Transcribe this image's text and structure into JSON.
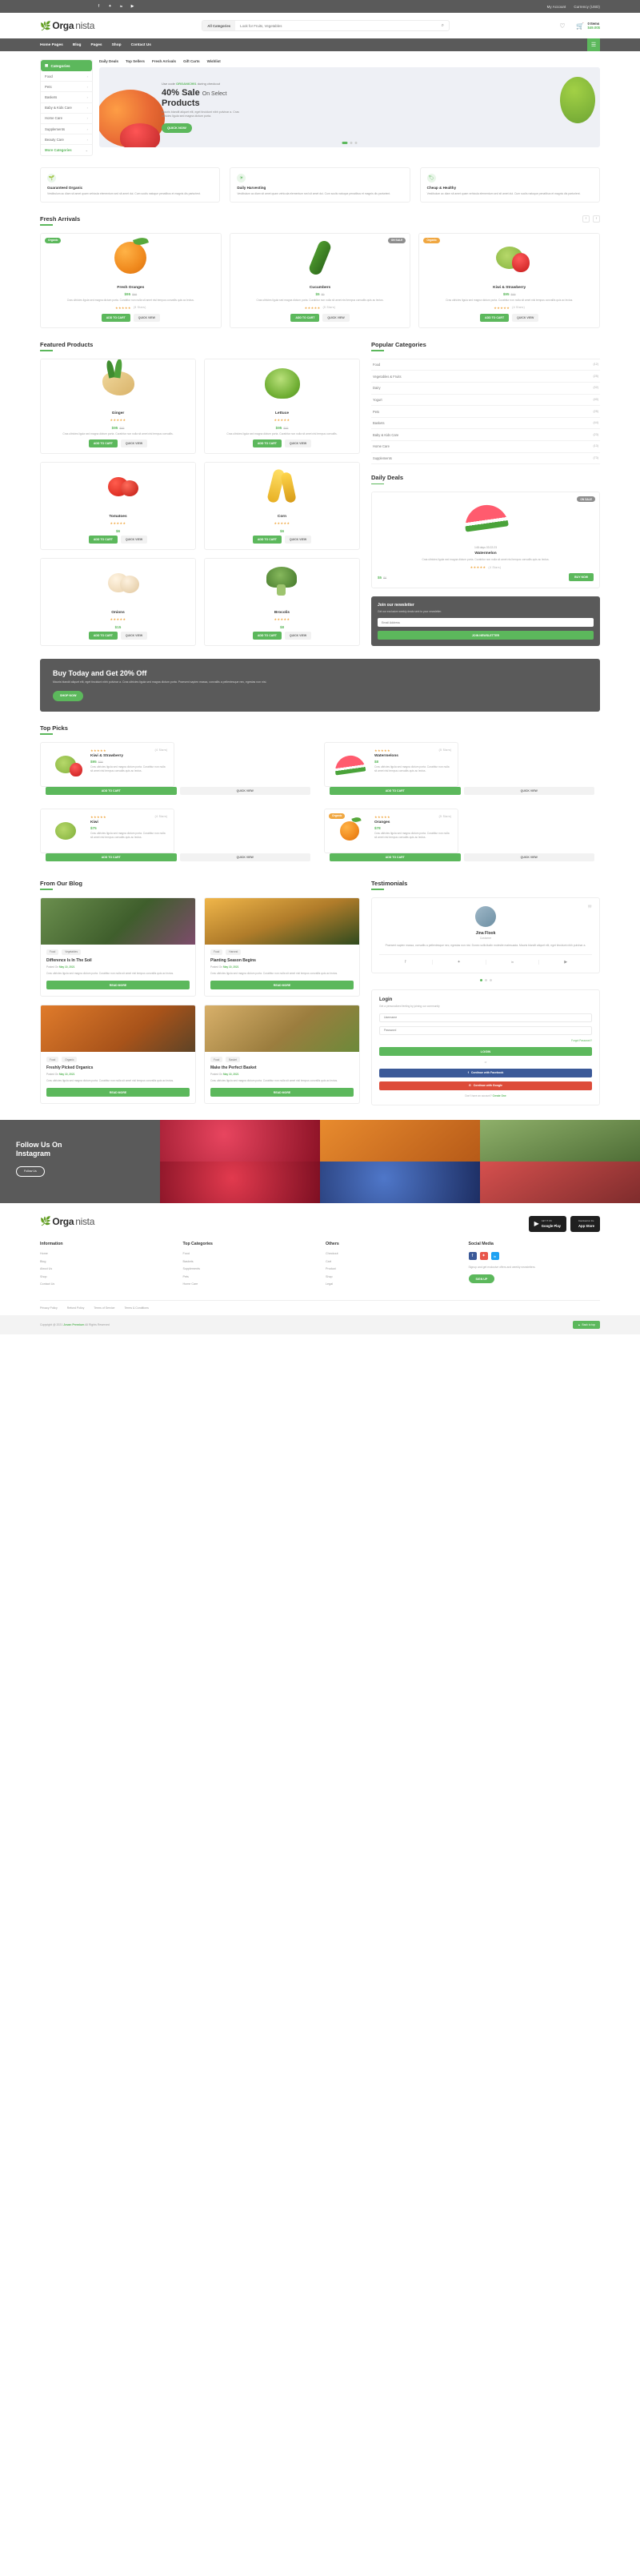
{
  "topbar": {
    "social": [
      "f",
      "t",
      "in",
      "yt"
    ],
    "links": [
      "My Account",
      "Currency (USD)"
    ]
  },
  "header": {
    "logo_main": "Orga",
    "logo_light": "nista",
    "search_category": "All Categories",
    "search_placeholder": "Look for Fruits, Vegetables",
    "wishlist_icon": "heart-icon",
    "cart_items": "0 Items",
    "cart_price": "$49.00$"
  },
  "nav": {
    "links": [
      "Home Pages",
      "Blog",
      "Pages",
      "Shop",
      "Contact Us"
    ]
  },
  "hero": {
    "categories_title": "Categories",
    "categories": [
      "Food",
      "Pets",
      "Baskets",
      "Baby & Kids Care",
      "Home Care",
      "Supplements",
      "Beauty Care"
    ],
    "more_label": "More Categories",
    "tabs": [
      "Daily Deals",
      "Top Sellers",
      "Fresh Arrivals",
      "Gift Carts",
      "Wishlist"
    ],
    "promo_code_pre": "Use code",
    "promo_code": "ORGANIC991",
    "promo_code_post": "during checkout",
    "promo_title_1": "40% Sale",
    "promo_title_2": "On Select",
    "promo_title_3": "Products",
    "promo_desc": "Mauris blandit aliquet elit, eget tincidunt nibh pulvinar a. Cras ultricies ligula sed magna dictum porta.",
    "promo_cta": "QUICK NOW"
  },
  "features": [
    {
      "icon": "leaf-icon",
      "title": "Guaranteed Organic",
      "desc": "Vestibulum ac diam sit amet quam vehicula elementum sed sit amet dui. Cum sociis natoque penatibus et magnis dis parturient."
    },
    {
      "icon": "sun-icon",
      "title": "Daily Harvesting",
      "desc": "Vestibulum ac diam sit amet quam vehicula elementum sed sit amet dui. Cum sociis natoque penatibus et magnis dis parturient."
    },
    {
      "icon": "tag-icon",
      "title": "Cheap & Healthy",
      "desc": "Vestibulum ac diam sit amet quam vehicula elementum sed sit amet dui. Cum sociis natoque penatibus et magnis dis parturient."
    }
  ],
  "fresh_arrivals": {
    "title": "Fresh Arrivals",
    "products": [
      {
        "badge": "Organic",
        "badge_type": "green",
        "name": "Fresh Oranges",
        "price": "$95",
        "old": "$99",
        "desc": "Cras ultricies ligula sed magna dictum porta. Curabitur non nulla sit amet nisl tempus convallis quis ac lectus.",
        "stars": "★★★★★",
        "reviews": "(5 Stars)",
        "cart": "ADD TO CART",
        "quick": "QUICK VIEW",
        "shape": "orange"
      },
      {
        "badge": "ON SALE",
        "badge_type": "grey",
        "name": "Cucumbers",
        "price": "$5",
        "old": "$9",
        "desc": "Cras ultricies ligula sed magna dictum porta. Curabitur non nulla sit amet nisl tempus convallis quis ac lectus.",
        "stars": "★★★★★",
        "reviews": "(5 Stars)",
        "cart": "ADD TO CART",
        "quick": "QUICK VIEW",
        "shape": "cucumber"
      },
      {
        "badge": "Organic",
        "badge_type": "orange",
        "name": "Kiwi & Strawberry",
        "price": "$95",
        "old": "$99",
        "desc": "Cras ultricies ligula sed magna dictum porta. Curabitur non nulla sit amet nisl tempus convallis quis ac lectus.",
        "stars": "★★★★★",
        "reviews": "(4 Stars)",
        "cart": "ADD TO CART",
        "quick": "QUICK VIEW",
        "shape": "kiwi"
      }
    ]
  },
  "featured": {
    "title": "Featured Products",
    "products": [
      {
        "name": "Ginger",
        "price": "$95",
        "old": "$99",
        "desc": "Cras ultricies ligula sed magna dictum porta. Curabitur non nulla sit amet nisl tempus convallis.",
        "stars": "★★★★★",
        "cart": "ADD TO CART",
        "quick": "QUICK VIEW",
        "shape": "ginger"
      },
      {
        "name": "Lettuce",
        "price": "$95",
        "old": "$99",
        "desc": "Cras ultricies ligula sed magna dictum porta. Curabitur non nulla sit amet nisl tempus convallis.",
        "stars": "★★★★★",
        "cart": "ADD TO CART",
        "quick": "QUICK VIEW",
        "shape": "lettuce"
      },
      {
        "name": "Tomatoes",
        "price": "$6",
        "old": "",
        "desc": "",
        "stars": "★★★★★",
        "cart": "ADD TO CART",
        "quick": "QUICK VIEW",
        "shape": "tomato"
      },
      {
        "name": "Corn",
        "price": "$6",
        "old": "",
        "desc": "",
        "stars": "★★★★★",
        "cart": "ADD TO CART",
        "quick": "QUICK VIEW",
        "shape": "corn"
      },
      {
        "name": "Onions",
        "price": "$15",
        "old": "",
        "desc": "",
        "stars": "★★★★★",
        "cart": "ADD TO CART",
        "quick": "QUICK VIEW",
        "shape": "onion"
      },
      {
        "name": "Brocolis",
        "price": "$8",
        "old": "",
        "desc": "",
        "stars": "★★★★★",
        "cart": "ADD TO CART",
        "quick": "QUICK VIEW",
        "shape": "broccoli"
      }
    ]
  },
  "popular_categories": {
    "title": "Popular Categories",
    "items": [
      {
        "name": "Food",
        "count": "(12)"
      },
      {
        "name": "Vegetables & Fruits",
        "count": "(25)"
      },
      {
        "name": "Dairy",
        "count": "(32)"
      },
      {
        "name": "Yogurt",
        "count": "(40)"
      },
      {
        "name": "Pets",
        "count": "(25)"
      },
      {
        "name": "Baskets",
        "count": "(44)"
      },
      {
        "name": "Baby & Kids Care",
        "count": "(23)"
      },
      {
        "name": "Home Care",
        "count": "(13)"
      },
      {
        "name": "Supplements",
        "count": "(73)"
      }
    ]
  },
  "daily_deals": {
    "title": "Daily Deals",
    "badge": "ON SALE",
    "countdown": "148 days 03:22:23",
    "name": "Watermelon",
    "desc": "Cras ultricies ligula sed magna dictum porta. Curabitur non nulla sit amet nisl tempus convallis quis ac lectus.",
    "stars": "★★★★★",
    "reviews": "(4 Stars)",
    "price": "$5",
    "old": "$8",
    "buy": "BUY NOW"
  },
  "newsletter": {
    "title": "Join our newsletter",
    "desc": "Get our exclusive weekly deals sent to your newsletter.",
    "placeholder": "Email Address",
    "button": "JOIN NEWSLETTER"
  },
  "cta": {
    "title": "Buy Today and Get 20% Off",
    "desc": "Mauris blandit aliquet elit, eget tincidunt nibh pulvinar a. Cras ultricies ligula sed magna dictum porta. Praesent sapien massa, convallis a pellentesque nec, egestas non nisi.",
    "button": "SHOP NOW"
  },
  "top_picks": {
    "title": "Top Picks",
    "items": [
      {
        "stars": "★★★★★",
        "reviews": "(4 Stars)",
        "name": "Kiwi & Strawberry",
        "price": "$95",
        "old": "$99",
        "desc": "Cras ultricies ligula sed magna dictum porta. Curabitur non nulla sit amet nisl tempus convallis quis ac lectus.",
        "cart": "ADD TO CART",
        "quick": "QUICK VIEW",
        "shape": "kiwi"
      },
      {
        "stars": "★★★★★",
        "reviews": "(5 Stars)",
        "name": "Watermelons",
        "price": "$8",
        "old": "",
        "desc": "Cras ultricies ligula sed magna dictum porta. Curabitur non nulla sit amet nisl tempus convallis quis ac lectus.",
        "cart": "ADD TO CART",
        "quick": "QUICK VIEW",
        "shape": "melon"
      },
      {
        "stars": "★★★★★",
        "reviews": "(4 Stars)",
        "name": "Kiwi",
        "price": "$75",
        "old": "",
        "desc": "Cras ultricies ligula sed magna dictum porta. Curabitur non nulla sit amet nisl tempus convallis quis ac lectus.",
        "cart": "ADD TO CART",
        "quick": "QUICK VIEW",
        "shape": "kiwi2"
      },
      {
        "stars": "★★★★★",
        "reviews": "(5 Stars)",
        "name": "Oranges",
        "price": "$78",
        "old": "",
        "desc": "Cras ultricies ligula sed magna dictum porta. Curabitur non nulla sit amet nisl tempus convallis quis ac lectus.",
        "cart": "ADD TO CART",
        "quick": "QUICK VIEW",
        "shape": "orange2",
        "badge": "Organic"
      }
    ]
  },
  "blog": {
    "title": "From Our Blog",
    "posts": [
      {
        "tags": [
          "Food",
          "Vegetables"
        ],
        "title": "Difference Is In The Soil",
        "meta_pre": "Posted On",
        "meta_date": "May 10, 2021",
        "desc": "Cras ultricies ligula sed magna dictum porta. Curabitur non nulla sit amet nisl tempus convallis quis ac lectus.",
        "button": "READ MORE",
        "img": "veg-basket"
      },
      {
        "tags": [
          "Food",
          "Harvest"
        ],
        "title": "Planting Season Begins",
        "meta_pre": "Posted On",
        "meta_date": "May 10, 2021",
        "desc": "Cras ultricies ligula sed magna dictum porta. Curabitur non nulla sit amet nisl tempus convallis quis ac lectus.",
        "button": "READ MORE",
        "img": "field-sunset"
      },
      {
        "tags": [
          "Food",
          "Organic"
        ],
        "title": "Freshly Picked Organics",
        "meta_pre": "Posted On",
        "meta_date": "May 10, 2021",
        "desc": "Cras ultricies ligula sed magna dictum porta. Curabitur non nulla sit amet nisl tempus convallis quis ac lectus.",
        "button": "READ MORE",
        "img": "carrots"
      },
      {
        "tags": [
          "Food",
          "Basket"
        ],
        "title": "Make the Perfect Basket",
        "meta_pre": "Posted On",
        "meta_date": "May 10, 2021",
        "desc": "Cras ultricies ligula sed magna dictum porta. Curabitur non nulla sit amet nisl tempus convallis quis ac lectus.",
        "button": "READ MORE",
        "img": "fruit-basket"
      }
    ]
  },
  "testimonials": {
    "title": "Testimonials",
    "name": "Jina Flook",
    "role": "Customer",
    "text": "Praesent sapien massa, convallis a pellentesque nec, egestas non nisi. Donec sollicitudin molestie malesuada. Mauris blandit aliquet elit, eget tincidunt nibh pulvinar a.",
    "socials": [
      "f",
      "t",
      "in",
      "yt"
    ]
  },
  "login": {
    "title": "Login",
    "desc": "Get a personalized feeling by joining our community",
    "username_placeholder": "Username",
    "password_placeholder": "Password",
    "forgot": "Forgot Password?",
    "button": "LOGIN",
    "or": "or",
    "facebook": "Continue with Facebook",
    "google": "Continue with Google",
    "signup_pre": "Don't have an account?",
    "signup_link": "Create One"
  },
  "instagram": {
    "title_1": "Follow Us On",
    "title_2": "Instagram",
    "button": "Follow Us"
  },
  "footer": {
    "logo_main": "Orga",
    "logo_light": "nista",
    "stores": [
      {
        "icon": "play-icon",
        "small": "GET IT ON",
        "big": "Google Play"
      },
      {
        "icon": "apple-icon",
        "small": "Download on the",
        "big": "App Store"
      }
    ],
    "columns": [
      {
        "title": "Information",
        "items": [
          "Home",
          "Blog",
          "About Us",
          "Shop",
          "Contact Us"
        ]
      },
      {
        "title": "Top Categories",
        "items": [
          "Food",
          "Baskets",
          "Supplements",
          "Pets",
          "Home Care"
        ]
      },
      {
        "title": "Others",
        "items": [
          "Checkout",
          "Cart",
          "Product",
          "Shop",
          "Legal"
        ]
      }
    ],
    "social_title": "Social Media",
    "social_icons": [
      "f",
      "t",
      "in"
    ],
    "social_desc": "Signup and get exclusive offers and weekly newsletters.",
    "social_button": "SIGN UP",
    "bottom_links": [
      "Privacy Policy",
      "Refund Policy",
      "Terms of Service",
      "Terms & Conditions"
    ],
    "copyright_pre": "Copyright @ 2021",
    "copyright_brand": "Jovan Premium",
    "copyright_post": "All Rights Reserved",
    "back_to_top": "Back to top"
  }
}
